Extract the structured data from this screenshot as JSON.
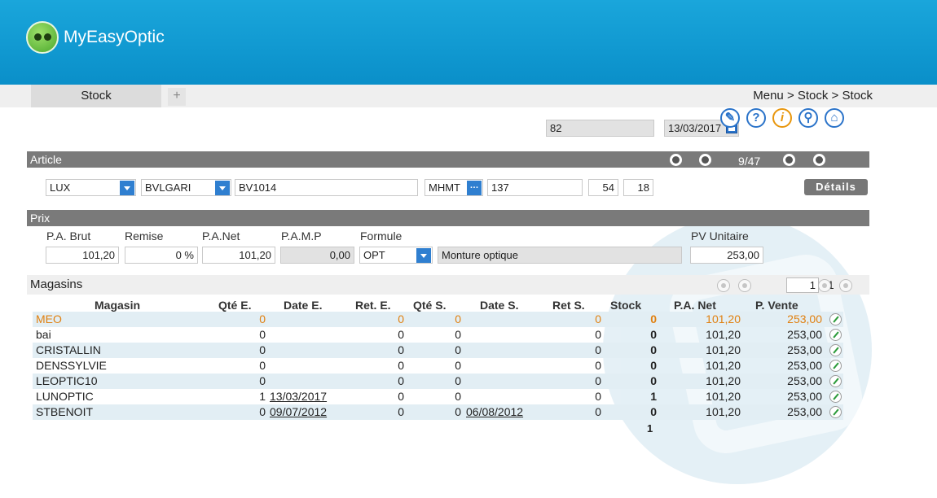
{
  "app": {
    "brand": "MyEasyOptic"
  },
  "tabs": [
    {
      "label": "Stock"
    }
  ],
  "tab_add": "+",
  "breadcrumb": "Menu > Stock > Stock",
  "top": {
    "code": "82",
    "date": "13/03/2017"
  },
  "icons": {
    "help": "?",
    "info": "i"
  },
  "article": {
    "title": "Article",
    "counter": "9/47",
    "type": "LUX",
    "brand": "BVLGARI",
    "reference": "BV1014",
    "supplier": "MHMT",
    "dots": "…",
    "color": "137",
    "size1": "54",
    "size2": "18",
    "details_label": "Détails"
  },
  "prix": {
    "title": "Prix",
    "labels": {
      "pa_brut": "P.A. Brut",
      "remise": "Remise",
      "pa_net": "P.A.Net",
      "pamp": "P.A.M.P",
      "formule": "Formule",
      "pv_unitaire": "PV Unitaire"
    },
    "values": {
      "pa_brut": "101,20",
      "remise": "0 %",
      "pa_net": "101,20",
      "pamp": "0,00",
      "formule": "OPT",
      "formule_desc": "Monture optique",
      "pv_unitaire": "253,00"
    }
  },
  "magasins": {
    "title": "Magasins",
    "page": "1",
    "page_total": "/1",
    "columns": [
      "Magasin",
      "Qté E.",
      "Date E.",
      "Ret. E.",
      "Qté S.",
      "Date S.",
      "Ret S.",
      "Stock",
      "P.A. Net",
      "P. Vente"
    ],
    "rows": [
      {
        "magasin": "MEO",
        "qte_e": "0",
        "date_e": "",
        "ret_e": "0",
        "qte_s": "0",
        "date_s": "",
        "ret_s": "0",
        "stock": "0",
        "pa_net": "101,20",
        "p_vente": "253,00"
      },
      {
        "magasin": "bai",
        "qte_e": "0",
        "date_e": "",
        "ret_e": "0",
        "qte_s": "0",
        "date_s": "",
        "ret_s": "0",
        "stock": "0",
        "pa_net": "101,20",
        "p_vente": "253,00"
      },
      {
        "magasin": "CRISTALLIN",
        "qte_e": "0",
        "date_e": "",
        "ret_e": "0",
        "qte_s": "0",
        "date_s": "",
        "ret_s": "0",
        "stock": "0",
        "pa_net": "101,20",
        "p_vente": "253,00"
      },
      {
        "magasin": "DENSSYLVIE",
        "qte_e": "0",
        "date_e": "",
        "ret_e": "0",
        "qte_s": "0",
        "date_s": "",
        "ret_s": "0",
        "stock": "0",
        "pa_net": "101,20",
        "p_vente": "253,00"
      },
      {
        "magasin": "LEOPTIC10",
        "qte_e": "0",
        "date_e": "",
        "ret_e": "0",
        "qte_s": "0",
        "date_s": "",
        "ret_s": "0",
        "stock": "0",
        "pa_net": "101,20",
        "p_vente": "253,00"
      },
      {
        "magasin": "LUNOPTIC",
        "qte_e": "1",
        "date_e": "13/03/2017",
        "ret_e": "0",
        "qte_s": "0",
        "date_s": "",
        "ret_s": "0",
        "stock": "1",
        "pa_net": "101,20",
        "p_vente": "253,00"
      },
      {
        "magasin": "STBENOIT",
        "qte_e": "0",
        "date_e": "09/07/2012",
        "ret_e": "0",
        "qte_s": "0",
        "date_s": "06/08/2012",
        "ret_s": "0",
        "stock": "0",
        "pa_net": "101,20",
        "p_vente": "253,00"
      }
    ],
    "stock_total": "1"
  },
  "colors": {
    "header": "#0a8fc9",
    "section": "#7a7a7a",
    "highlight": "#e08010",
    "row_alt": "#e2eef4",
    "dropdown": "#2f7fd0"
  }
}
